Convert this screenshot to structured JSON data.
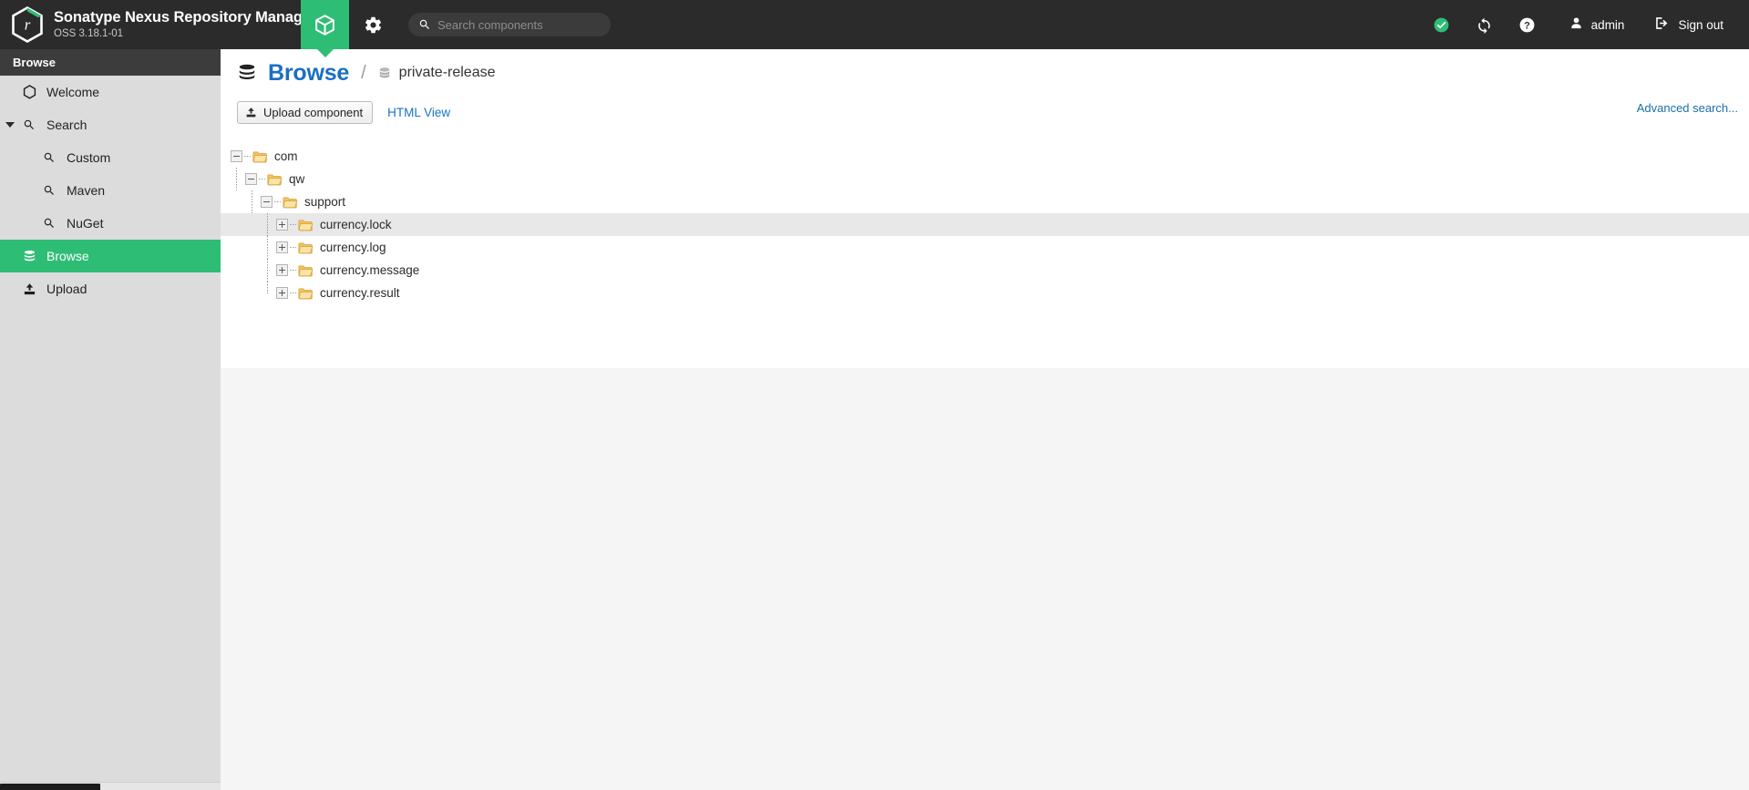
{
  "header": {
    "brand_title": "Sonatype Nexus Repository Manager",
    "brand_version": "OSS 3.18.1-01",
    "logo_icon": "nexus-hexagon-logo",
    "tabs": [
      {
        "name": "repository-tab",
        "icon": "cube-icon",
        "active": true
      },
      {
        "name": "admin-tab",
        "icon": "gear-icon",
        "active": false
      }
    ],
    "search": {
      "placeholder": "Search components",
      "value": "",
      "icon": "search-icon"
    },
    "right_items": [
      {
        "name": "status-ok-icon",
        "icon": "check-circle-icon",
        "label": "",
        "color": "#2ebd75"
      },
      {
        "name": "refresh-icon",
        "icon": "sync-icon",
        "label": ""
      },
      {
        "name": "help-icon",
        "icon": "question-circle-icon",
        "label": ""
      },
      {
        "name": "user-menu",
        "icon": "user-icon",
        "label": "admin"
      },
      {
        "name": "sign-out",
        "icon": "sign-out-icon",
        "label": "Sign out"
      }
    ]
  },
  "sidebar": {
    "section_title": "Browse",
    "items": [
      {
        "label": "Welcome",
        "icon": "hexagon-icon",
        "level": 0,
        "active": false,
        "expandable": false
      },
      {
        "label": "Search",
        "icon": "search-icon",
        "level": 0,
        "active": false,
        "expandable": true,
        "expanded": true
      },
      {
        "label": "Custom",
        "icon": "search-icon",
        "level": 1,
        "active": false,
        "expandable": false
      },
      {
        "label": "Maven",
        "icon": "search-icon",
        "level": 1,
        "active": false,
        "expandable": false
      },
      {
        "label": "NuGet",
        "icon": "search-icon",
        "level": 1,
        "active": false,
        "expandable": false
      },
      {
        "label": "Browse",
        "icon": "database-icon",
        "level": 0,
        "active": true,
        "expandable": false
      },
      {
        "label": "Upload",
        "icon": "upload-icon",
        "level": 0,
        "active": false,
        "expandable": false
      }
    ],
    "active_color": "#2ebd75"
  },
  "main": {
    "breadcrumb": {
      "icon": "database-icon",
      "root_label": "Browse",
      "separator": "/",
      "repo_icon": "database-small-icon",
      "repo_label": "private-release",
      "root_color": "#1a6fc4"
    },
    "toolbar": {
      "upload_button_label": "Upload component",
      "upload_button_icon": "upload-icon",
      "html_view_label": "HTML View",
      "advanced_search_label": "Advanced search...",
      "link_color": "#1a73c7"
    },
    "tree": {
      "nodes": [
        {
          "label": "com",
          "level": 0,
          "state": "expanded",
          "selected": false,
          "icon": "folder-open-icon"
        },
        {
          "label": "qw",
          "level": 1,
          "state": "expanded",
          "selected": false,
          "icon": "folder-open-icon"
        },
        {
          "label": "support",
          "level": 2,
          "state": "expanded",
          "selected": false,
          "icon": "folder-open-icon"
        },
        {
          "label": "currency.lock",
          "level": 3,
          "state": "collapsed",
          "selected": true,
          "icon": "folder-open-icon"
        },
        {
          "label": "currency.log",
          "level": 3,
          "state": "collapsed",
          "selected": false,
          "icon": "folder-open-icon"
        },
        {
          "label": "currency.message",
          "level": 3,
          "state": "collapsed",
          "selected": false,
          "icon": "folder-open-icon"
        },
        {
          "label": "currency.result",
          "level": 3,
          "state": "collapsed",
          "selected": false,
          "icon": "folder-open-icon"
        }
      ],
      "selected_row_color": "#e8e8e8"
    }
  }
}
